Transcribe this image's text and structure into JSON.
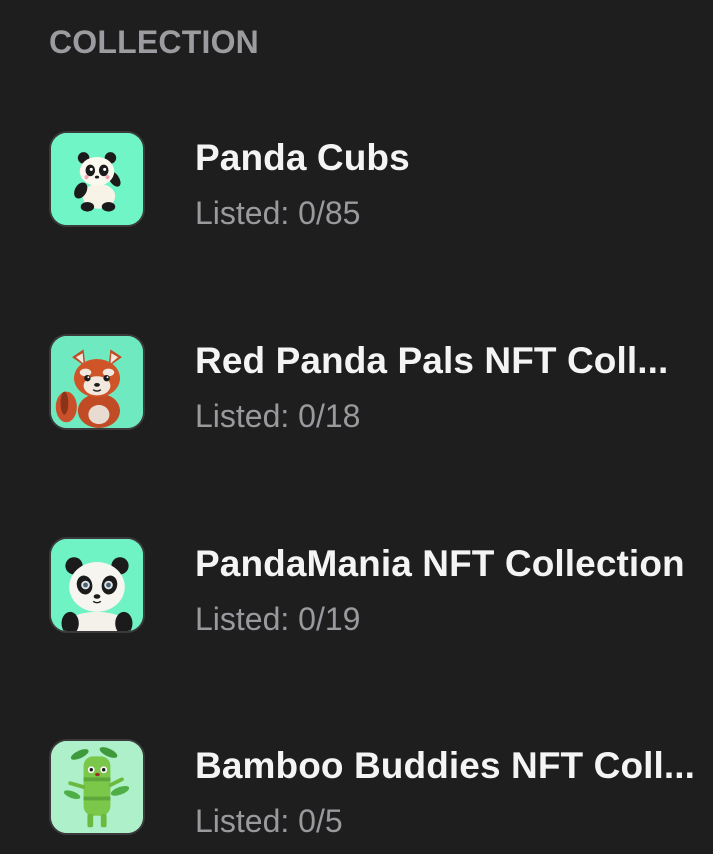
{
  "section": {
    "title": "COLLECTION"
  },
  "collections": [
    {
      "name": "Panda Cubs",
      "listed": "Listed: 0/85",
      "icon": "panda-cub-icon",
      "bg": "#6ff5c6"
    },
    {
      "name": "Red Panda Pals NFT Coll...",
      "listed": "Listed: 0/18",
      "icon": "red-panda-icon",
      "bg": "#6fe9bf"
    },
    {
      "name": "PandaMania NFT Collection",
      "listed": "Listed: 0/19",
      "icon": "panda-face-icon",
      "bg": "#6ff2c4"
    },
    {
      "name": "Bamboo Buddies NFT Coll...",
      "listed": "Listed: 0/5",
      "icon": "bamboo-buddy-icon",
      "bg": "#aef0c9"
    }
  ]
}
